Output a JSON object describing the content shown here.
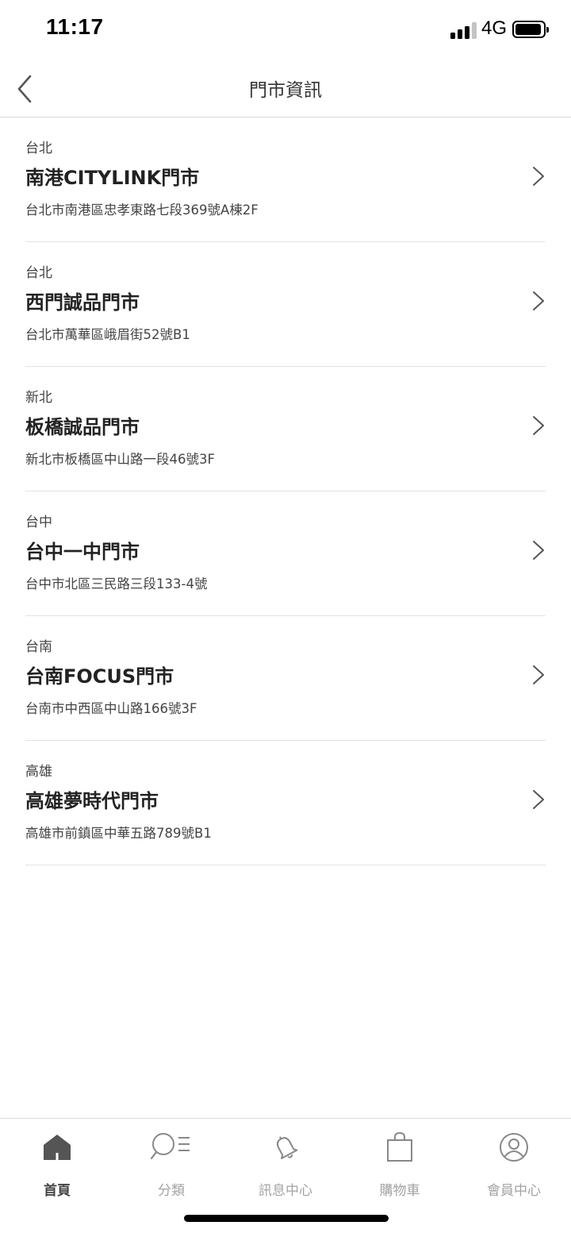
{
  "status_bar": {
    "time": "11:17",
    "network": "4G",
    "icons": [
      "signal-icon",
      "battery-icon"
    ]
  },
  "nav": {
    "title": "門市資訊",
    "back_icon": "chevron-left-icon"
  },
  "stores": [
    {
      "region": "台北",
      "name": "南港CITYLINK門市",
      "address": "台北市南港區忠孝東路七段369號A棟2F"
    },
    {
      "region": "台北",
      "name": "西門誠品門市",
      "address": "台北市萬華區峨眉街52號B1"
    },
    {
      "region": "新北",
      "name": "板橋誠品門市",
      "address": "新北市板橋區中山路一段46號3F"
    },
    {
      "region": "台中",
      "name": "台中一中門市",
      "address": "台中市北區三民路三段133-4號"
    },
    {
      "region": "台南",
      "name": "台南FOCUS門市",
      "address": "台南市中西區中山路166號3F"
    },
    {
      "region": "高雄",
      "name": "高雄夢時代門市",
      "address": "高雄市前鎮區中華五路789號B1"
    }
  ],
  "tabs": [
    {
      "label": "首頁",
      "icon": "home-icon",
      "active": true
    },
    {
      "label": "分類",
      "icon": "category-search-icon",
      "active": false
    },
    {
      "label": "訊息中心",
      "icon": "bell-icon",
      "active": false
    },
    {
      "label": "購物車",
      "icon": "shopping-bag-icon",
      "active": false
    },
    {
      "label": "會員中心",
      "icon": "user-icon",
      "active": false
    }
  ],
  "colors": {
    "active_tab": "#555555",
    "inactive_tab": "#a3a3a3",
    "divider": "#e3e3e3"
  }
}
